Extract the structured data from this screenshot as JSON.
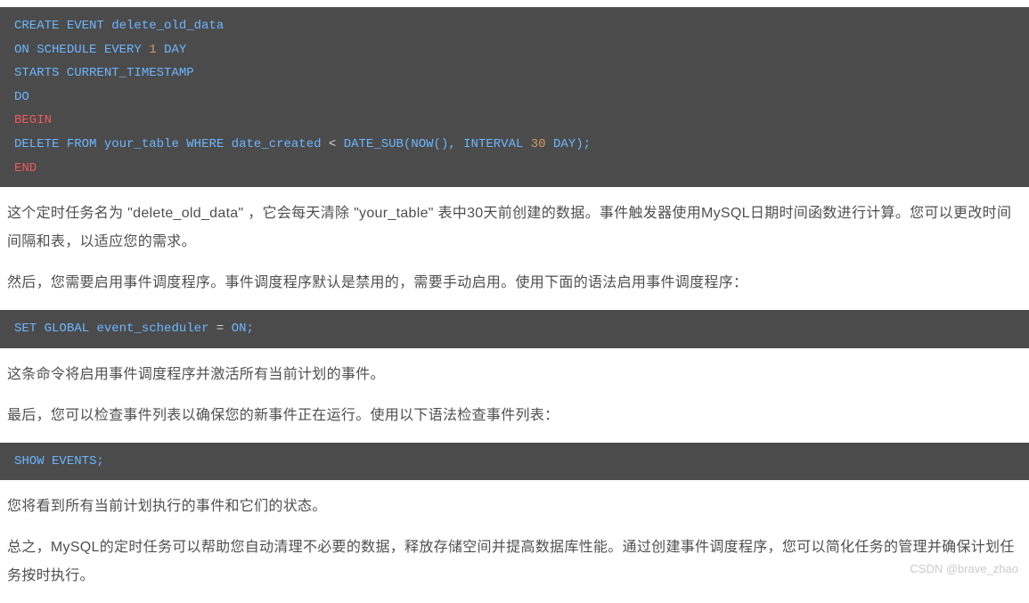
{
  "code1": {
    "l1": {
      "a": "CREATE",
      "b": " EVENT delete_old_data"
    },
    "l2": {
      "a": "ON",
      "b": " SCHEDULE EVERY ",
      "c": "1",
      "d": " DAY"
    },
    "l3": {
      "a": "STARTS CURRENT_TIMESTAMP"
    },
    "l4": {
      "a": "DO"
    },
    "l5": {
      "a": "BEGIN"
    },
    "l6": {
      "a": "DELETE",
      "b": " ",
      "c": "FROM",
      "d": " your_table ",
      "e": "WHERE",
      "f": " date_created ",
      "g": "<",
      "h": " DATE_SUB(",
      "i": "NOW",
      "j": "(), ",
      "k": "INTERVAL",
      "l": " ",
      "m": "30",
      "n": " ",
      "o": "DAY",
      "p": ");"
    },
    "l7": {
      "a": "END"
    }
  },
  "para1": "这个定时任务名为 \"delete_old_data\" ，它会每天清除 \"your_table\" 表中30天前创建的数据。事件触发器使用MySQL日期时间函数进行计算。您可以更改时间间隔和表，以适应您的需求。",
  "para2": "然后，您需要启用事件调度程序。事件调度程序默认是禁用的，需要手动启用。使用下面的语法启用事件调度程序：",
  "code2": {
    "a": "SET",
    "b": " ",
    "c": "GLOBAL",
    "d": " event_scheduler ",
    "e": "=",
    "f": " ",
    "g": "ON",
    "h": ";"
  },
  "para3": "这条命令将启用事件调度程序并激活所有当前计划的事件。",
  "para4": "最后，您可以检查事件列表以确保您的新事件正在运行。使用以下语法检查事件列表：",
  "code3": {
    "a": "SHOW",
    "b": " EVENTS;"
  },
  "para5": "您将看到所有当前计划执行的事件和它们的状态。",
  "para6": "总之，MySQL的定时任务可以帮助您自动清理不必要的数据，释放存储空间并提高数据库性能。通过创建事件调度程序，您可以简化任务的管理并确保计划任务按时执行。",
  "watermark": "CSDN @brave_zhao"
}
